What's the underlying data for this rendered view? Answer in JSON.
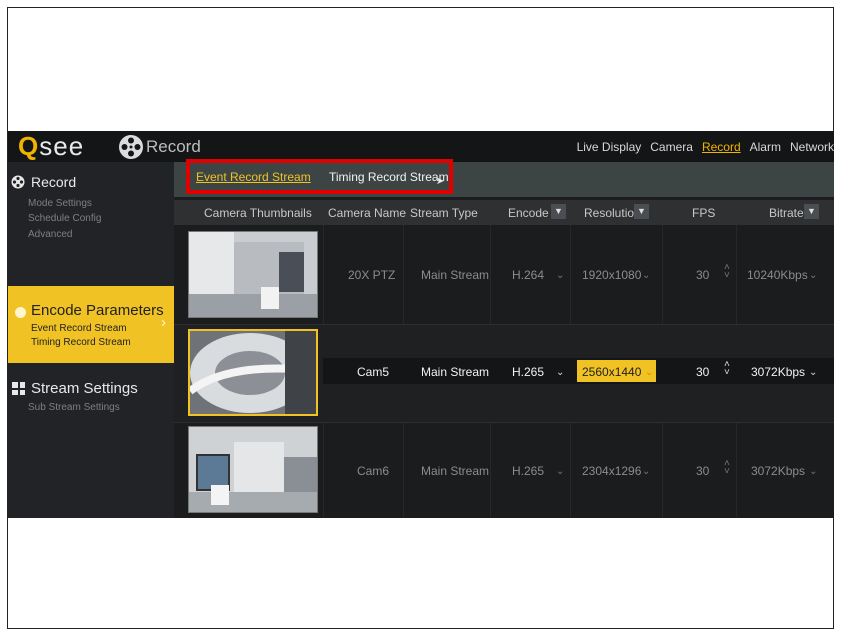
{
  "logo": {
    "q": "Q",
    "rest": "see"
  },
  "window_title": "Record",
  "nav": [
    "Live Display",
    "Camera",
    "Record",
    "Alarm",
    "Network"
  ],
  "nav_active": "Record",
  "sidebar": {
    "record": {
      "label": "Record",
      "items": [
        "Mode Settings",
        "Schedule Config",
        "Advanced"
      ]
    },
    "encode": {
      "label": "Encode Parameters",
      "items": [
        "Event Record Stream",
        "Timing Record Stream"
      ]
    },
    "stream": {
      "label": "Stream Settings",
      "items": [
        "Sub Stream Settings"
      ]
    }
  },
  "tabs": {
    "event": "Event Record Stream",
    "timing": "Timing Record Stream"
  },
  "columns": {
    "thumb": "Camera Thumbnails",
    "name": "Camera Name",
    "type": "Stream Type",
    "encode": "Encode",
    "resolution": "Resolution",
    "fps": "FPS",
    "bitrate": "Bitrate"
  },
  "rows": [
    {
      "name": "20X PTZ",
      "type": "Main Stream",
      "encode": "H.264",
      "resolution": "1920x1080",
      "fps": "30",
      "bitrate": "10240Kbps"
    },
    {
      "name": "Cam5",
      "type": "Main Stream",
      "encode": "H.265",
      "resolution": "2560x1440",
      "fps": "30",
      "bitrate": "3072Kbps"
    },
    {
      "name": "Cam6",
      "type": "Main Stream",
      "encode": "H.265",
      "resolution": "2304x1296",
      "fps": "30",
      "bitrate": "3072Kbps"
    }
  ],
  "colors": {
    "accent": "#f0c224",
    "highlight": "#e00000",
    "background": "#1b1c1e"
  }
}
